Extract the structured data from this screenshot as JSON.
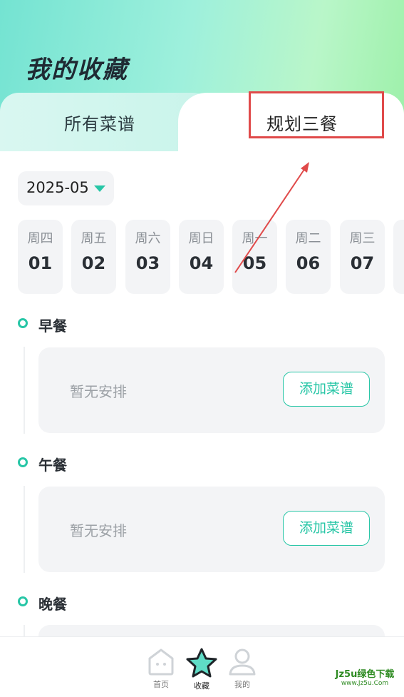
{
  "header": {
    "title": "我的收藏"
  },
  "tabs": [
    {
      "label": "所有菜谱",
      "active": false
    },
    {
      "label": "规划三餐",
      "active": true
    }
  ],
  "month": {
    "value": "2025-05"
  },
  "days": [
    {
      "weekday": "周四",
      "date": "01"
    },
    {
      "weekday": "周五",
      "date": "02"
    },
    {
      "weekday": "周六",
      "date": "03"
    },
    {
      "weekday": "周日",
      "date": "04"
    },
    {
      "weekday": "周一",
      "date": "05"
    },
    {
      "weekday": "周二",
      "date": "06"
    },
    {
      "weekday": "周三",
      "date": "07"
    }
  ],
  "meals": [
    {
      "title": "早餐",
      "empty_text": "暂无安排",
      "add_label": "添加菜谱"
    },
    {
      "title": "午餐",
      "empty_text": "暂无安排",
      "add_label": "添加菜谱"
    },
    {
      "title": "晚餐"
    }
  ],
  "tabbar": [
    {
      "label": "首页",
      "icon": "home-icon"
    },
    {
      "label": "收藏",
      "icon": "star-icon",
      "active": true
    },
    {
      "label": "我的",
      "icon": "profile-icon"
    }
  ],
  "watermark": {
    "top": "Jz5u绿色下载",
    "bottom": "www.Jz5u.Com"
  },
  "colors": {
    "accent": "#27c6a6",
    "highlight": "#e04a4a",
    "card_bg": "#f3f4f6"
  }
}
